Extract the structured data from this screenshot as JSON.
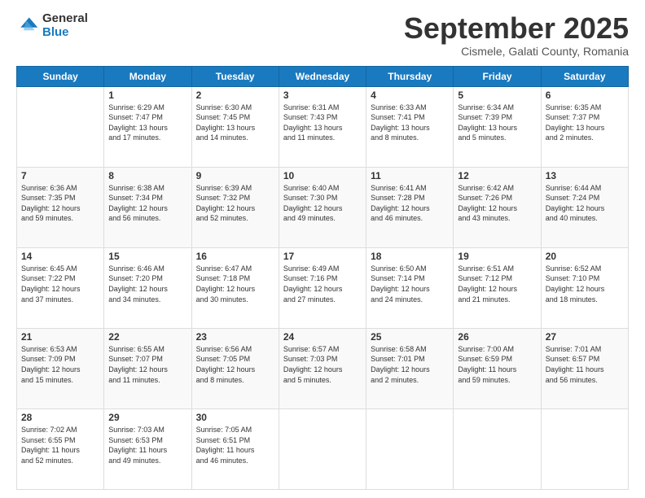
{
  "logo": {
    "general": "General",
    "blue": "Blue"
  },
  "header": {
    "month": "September 2025",
    "location": "Cismele, Galati County, Romania"
  },
  "days": [
    "Sunday",
    "Monday",
    "Tuesday",
    "Wednesday",
    "Thursday",
    "Friday",
    "Saturday"
  ],
  "weeks": [
    [
      {
        "day": "",
        "content": ""
      },
      {
        "day": "1",
        "content": "Sunrise: 6:29 AM\nSunset: 7:47 PM\nDaylight: 13 hours\nand 17 minutes."
      },
      {
        "day": "2",
        "content": "Sunrise: 6:30 AM\nSunset: 7:45 PM\nDaylight: 13 hours\nand 14 minutes."
      },
      {
        "day": "3",
        "content": "Sunrise: 6:31 AM\nSunset: 7:43 PM\nDaylight: 13 hours\nand 11 minutes."
      },
      {
        "day": "4",
        "content": "Sunrise: 6:33 AM\nSunset: 7:41 PM\nDaylight: 13 hours\nand 8 minutes."
      },
      {
        "day": "5",
        "content": "Sunrise: 6:34 AM\nSunset: 7:39 PM\nDaylight: 13 hours\nand 5 minutes."
      },
      {
        "day": "6",
        "content": "Sunrise: 6:35 AM\nSunset: 7:37 PM\nDaylight: 13 hours\nand 2 minutes."
      }
    ],
    [
      {
        "day": "7",
        "content": "Sunrise: 6:36 AM\nSunset: 7:35 PM\nDaylight: 12 hours\nand 59 minutes."
      },
      {
        "day": "8",
        "content": "Sunrise: 6:38 AM\nSunset: 7:34 PM\nDaylight: 12 hours\nand 56 minutes."
      },
      {
        "day": "9",
        "content": "Sunrise: 6:39 AM\nSunset: 7:32 PM\nDaylight: 12 hours\nand 52 minutes."
      },
      {
        "day": "10",
        "content": "Sunrise: 6:40 AM\nSunset: 7:30 PM\nDaylight: 12 hours\nand 49 minutes."
      },
      {
        "day": "11",
        "content": "Sunrise: 6:41 AM\nSunset: 7:28 PM\nDaylight: 12 hours\nand 46 minutes."
      },
      {
        "day": "12",
        "content": "Sunrise: 6:42 AM\nSunset: 7:26 PM\nDaylight: 12 hours\nand 43 minutes."
      },
      {
        "day": "13",
        "content": "Sunrise: 6:44 AM\nSunset: 7:24 PM\nDaylight: 12 hours\nand 40 minutes."
      }
    ],
    [
      {
        "day": "14",
        "content": "Sunrise: 6:45 AM\nSunset: 7:22 PM\nDaylight: 12 hours\nand 37 minutes."
      },
      {
        "day": "15",
        "content": "Sunrise: 6:46 AM\nSunset: 7:20 PM\nDaylight: 12 hours\nand 34 minutes."
      },
      {
        "day": "16",
        "content": "Sunrise: 6:47 AM\nSunset: 7:18 PM\nDaylight: 12 hours\nand 30 minutes."
      },
      {
        "day": "17",
        "content": "Sunrise: 6:49 AM\nSunset: 7:16 PM\nDaylight: 12 hours\nand 27 minutes."
      },
      {
        "day": "18",
        "content": "Sunrise: 6:50 AM\nSunset: 7:14 PM\nDaylight: 12 hours\nand 24 minutes."
      },
      {
        "day": "19",
        "content": "Sunrise: 6:51 AM\nSunset: 7:12 PM\nDaylight: 12 hours\nand 21 minutes."
      },
      {
        "day": "20",
        "content": "Sunrise: 6:52 AM\nSunset: 7:10 PM\nDaylight: 12 hours\nand 18 minutes."
      }
    ],
    [
      {
        "day": "21",
        "content": "Sunrise: 6:53 AM\nSunset: 7:09 PM\nDaylight: 12 hours\nand 15 minutes."
      },
      {
        "day": "22",
        "content": "Sunrise: 6:55 AM\nSunset: 7:07 PM\nDaylight: 12 hours\nand 11 minutes."
      },
      {
        "day": "23",
        "content": "Sunrise: 6:56 AM\nSunset: 7:05 PM\nDaylight: 12 hours\nand 8 minutes."
      },
      {
        "day": "24",
        "content": "Sunrise: 6:57 AM\nSunset: 7:03 PM\nDaylight: 12 hours\nand 5 minutes."
      },
      {
        "day": "25",
        "content": "Sunrise: 6:58 AM\nSunset: 7:01 PM\nDaylight: 12 hours\nand 2 minutes."
      },
      {
        "day": "26",
        "content": "Sunrise: 7:00 AM\nSunset: 6:59 PM\nDaylight: 11 hours\nand 59 minutes."
      },
      {
        "day": "27",
        "content": "Sunrise: 7:01 AM\nSunset: 6:57 PM\nDaylight: 11 hours\nand 56 minutes."
      }
    ],
    [
      {
        "day": "28",
        "content": "Sunrise: 7:02 AM\nSunset: 6:55 PM\nDaylight: 11 hours\nand 52 minutes."
      },
      {
        "day": "29",
        "content": "Sunrise: 7:03 AM\nSunset: 6:53 PM\nDaylight: 11 hours\nand 49 minutes."
      },
      {
        "day": "30",
        "content": "Sunrise: 7:05 AM\nSunset: 6:51 PM\nDaylight: 11 hours\nand 46 minutes."
      },
      {
        "day": "",
        "content": ""
      },
      {
        "day": "",
        "content": ""
      },
      {
        "day": "",
        "content": ""
      },
      {
        "day": "",
        "content": ""
      }
    ]
  ]
}
